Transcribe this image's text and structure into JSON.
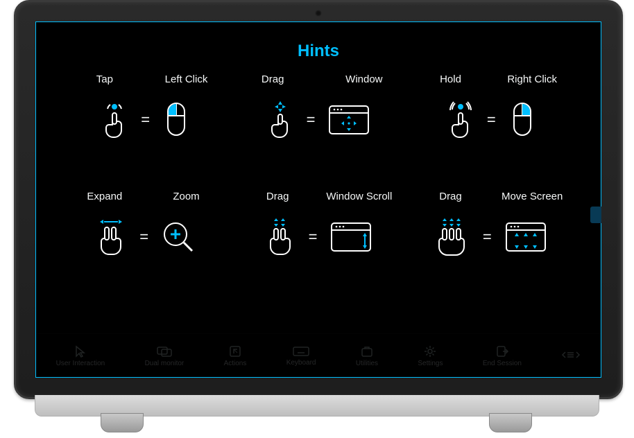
{
  "title": "Hints",
  "accent": "#00bfff",
  "hints": [
    {
      "gesture": "Tap",
      "result": "Left Click"
    },
    {
      "gesture": "Drag",
      "result": "Window"
    },
    {
      "gesture": "Hold",
      "result": "Right Click"
    },
    {
      "gesture": "Expand",
      "result": "Zoom"
    },
    {
      "gesture": "Drag",
      "result": "Window Scroll"
    },
    {
      "gesture": "Drag",
      "result": "Move Screen"
    }
  ],
  "toolbar": [
    {
      "icon": "cursor-icon",
      "label": "User Interaction"
    },
    {
      "icon": "dual-monitor-icon",
      "label": "Dual monitor"
    },
    {
      "icon": "actions-icon",
      "label": "Actions"
    },
    {
      "icon": "keyboard-icon",
      "label": "Keyboard"
    },
    {
      "icon": "utilities-icon",
      "label": "Utilities"
    },
    {
      "icon": "settings-icon",
      "label": "Settings"
    },
    {
      "icon": "end-session-icon",
      "label": "End Session"
    },
    {
      "icon": "expand-panel-icon",
      "label": ""
    }
  ],
  "eq": "="
}
